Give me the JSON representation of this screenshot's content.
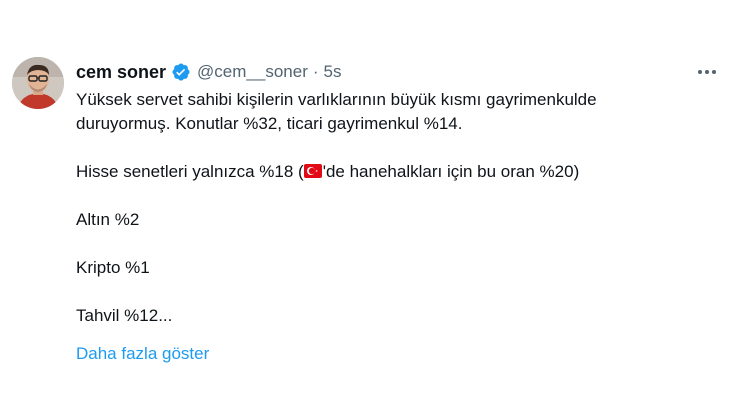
{
  "tweet": {
    "author": {
      "display_name": "cem soner",
      "handle": "@cem__soner",
      "verified": true,
      "verified_color": "#1d9bf0"
    },
    "separator": "·",
    "time": "5s",
    "more_icon": "more-horizontal-icon",
    "text": {
      "line1": "Yüksek servet sahibi kişilerin varlıklarının büyük kısmı gayrimenkulde",
      "line2": "duruyormuş. Konutlar %32, ticari gayrimenkul %14.",
      "line3_before_flag": "Hisse senetleri yalnızca %18 (",
      "flag_icon": "turkey-flag-icon",
      "line3_after_flag": "'de hanehalkları için bu oran %20)",
      "line4": "Altın %2",
      "line5": "Kripto %1",
      "line6": "Tahvil %12..."
    },
    "show_more": "Daha fazla göster",
    "colors": {
      "text": "#0f1419",
      "secondary": "#536471",
      "link": "#1d9bf0"
    }
  }
}
